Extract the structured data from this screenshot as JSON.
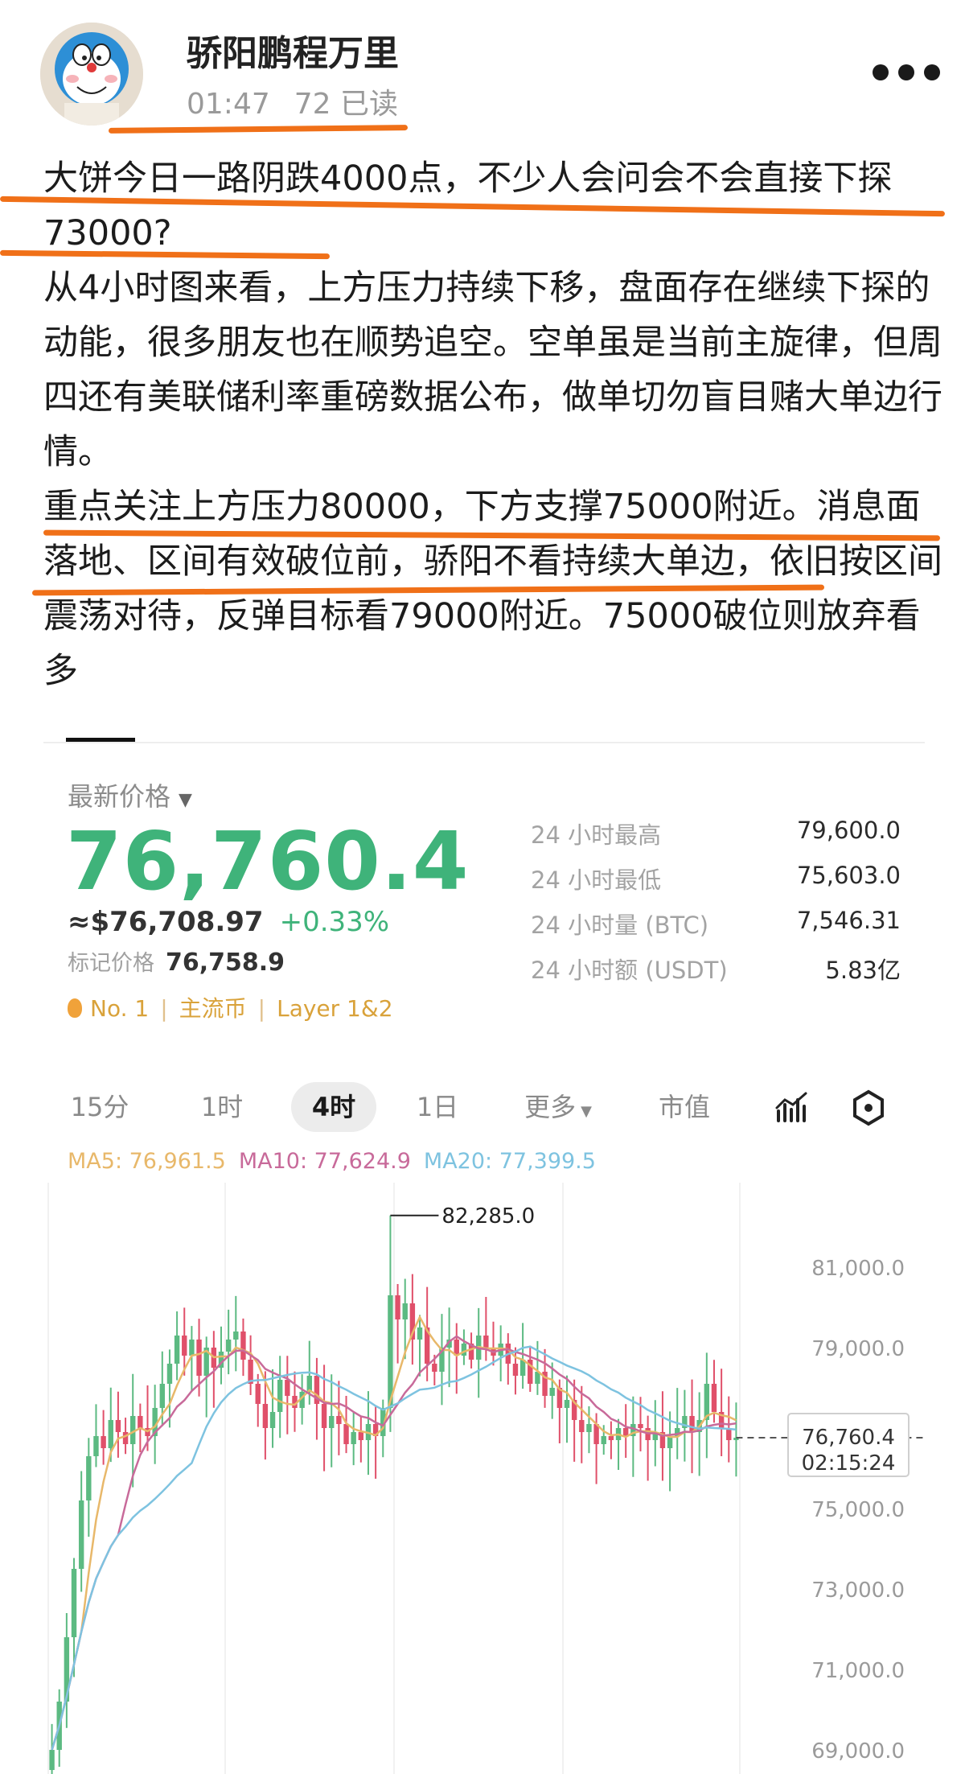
{
  "post": {
    "author": "骄阳鹏程万里",
    "time": "01:47",
    "reads": "72 已读",
    "paragraphs": [
      "大饼今日一路阴跌4000点，不少人会问会不会直接下探73000?",
      "从4小时图来看，上方压力持续下移，盘面存在继续下探的动能，很多朋友也在顺势追空。空单虽是当前主旋律，但周四还有美联储利率重磅数据公布，做单切勿盲目赌大单边行情。",
      "重点关注上方压力80000，下方支撑75000附近。消息面落地、区间有效破位前，骄阳不看持续大单边，依旧按区间震荡对待，反弹目标看79000附近。75000破位则放弃看多"
    ]
  },
  "ticker": {
    "label": "最新价格",
    "price": "76,760.4",
    "usd_price": "≈$76,708.97",
    "change": "+0.33%",
    "mark_label": "标记价格",
    "mark_price": "76,758.9",
    "tags": [
      "No. 1",
      "主流币",
      "Layer 1&2"
    ],
    "stats": [
      {
        "label": "24 小时最高",
        "value": "79,600.0"
      },
      {
        "label": "24 小时最低",
        "value": "75,603.0"
      },
      {
        "label": "24 小时量 (BTC)",
        "value": "7,546.31"
      },
      {
        "label": "24 小时额 (USDT)",
        "value": "5.83亿"
      }
    ]
  },
  "chart_tabs": [
    "15分",
    "1时",
    "4时",
    "1日",
    "更多",
    "市值"
  ],
  "active_tab": "4时",
  "ma": {
    "ma5": "MA5: 76,961.5",
    "ma10": "MA10: 77,624.9",
    "ma20": "MA20: 77,399.5",
    "ma5_color": "#e8b86a",
    "ma10_color": "#c86a9a",
    "ma20_color": "#7ec3e0"
  },
  "colors": {
    "up": "#5cba82",
    "down": "#e0506a",
    "highlight": "#f07018",
    "price_green": "#3fb37a"
  },
  "chart_data": {
    "type": "candlestick",
    "y_ticks": [
      "81,000.0",
      "79,000.0",
      "77,000.0",
      "75,000.0",
      "73,000.0",
      "71,000.0",
      "69,000.0"
    ],
    "high_label": "82,285.0",
    "high_value": 82285,
    "last_price": "76,760.4",
    "countdown": "02:15:24",
    "ylim": [
      68500,
      82800
    ],
    "closes": [
      69000,
      70200,
      71800,
      73500,
      75200,
      76300,
      76800,
      76500,
      77200,
      76900,
      76600,
      77300,
      77000,
      76800,
      77500,
      78100,
      78600,
      79300,
      78800,
      79200,
      78300,
      79000,
      78500,
      78900,
      79200,
      79400,
      78700,
      78100,
      77600,
      77000,
      77400,
      78200,
      77800,
      77500,
      77900,
      78300,
      77600,
      77000,
      77300,
      77100,
      76600,
      76900,
      76700,
      77100,
      76800,
      77500,
      80300,
      79700,
      80100,
      79200,
      79500,
      78600,
      78400,
      79000,
      79200,
      78800,
      79100,
      78700,
      79300,
      79000,
      78800,
      79100,
      78600,
      78300,
      78700,
      78100,
      78400,
      77800,
      78000,
      77500,
      77700,
      77200,
      76900,
      77100,
      76600,
      76800,
      76700,
      77000,
      76800,
      77100,
      77000,
      76700,
      76900,
      76500,
      76800,
      77000,
      77300,
      76900,
      77200,
      78100,
      77400,
      77000,
      76700,
      76760
    ]
  }
}
